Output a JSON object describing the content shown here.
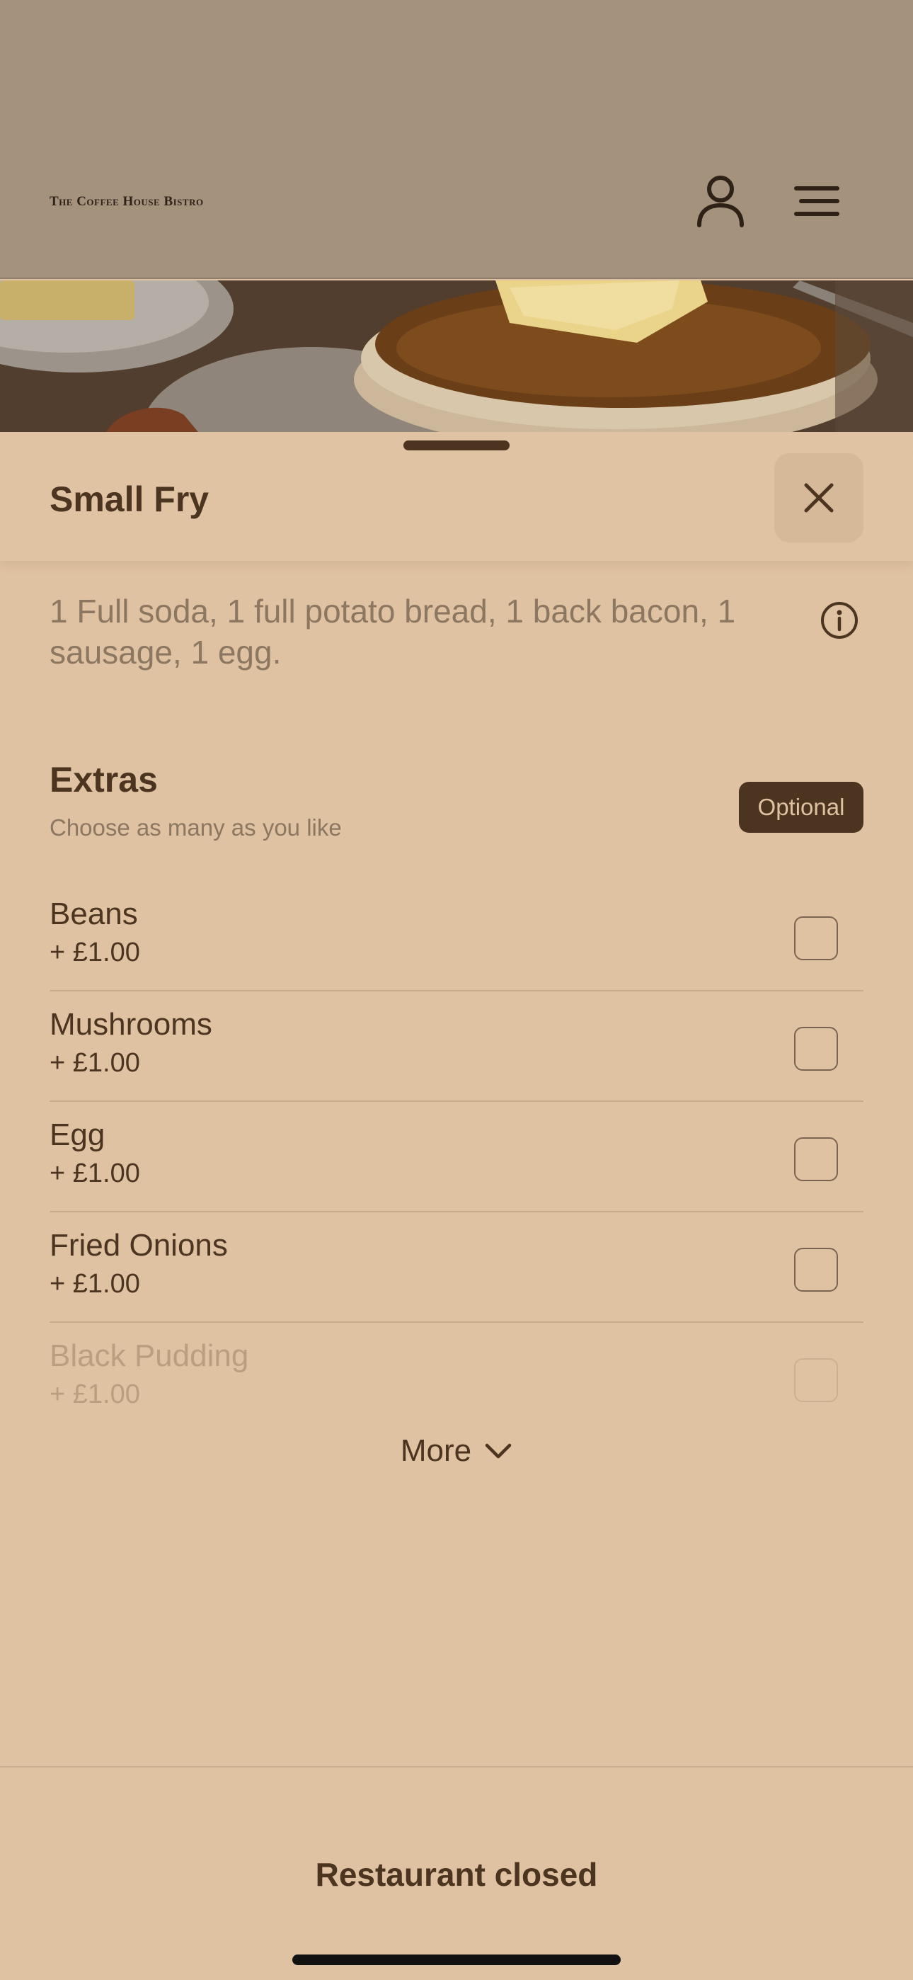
{
  "header": {
    "logo_text": "The Coffee House Bistro",
    "account_icon": "user-icon",
    "menu_icon": "hamburger-menu-icon"
  },
  "item": {
    "title": "Small Fry",
    "close_icon": "close-icon",
    "description": "1 Full soda, 1 full potato bread, 1 back bacon, 1 sausage, 1 egg.",
    "info_icon": "info-icon"
  },
  "extras": {
    "title": "Extras",
    "subtitle": "Choose as many as you like",
    "badge": "Optional",
    "options": [
      {
        "name": "Beans",
        "price": "+ £1.00",
        "checked": false
      },
      {
        "name": "Mushrooms",
        "price": "+ £1.00",
        "checked": false
      },
      {
        "name": "Egg",
        "price": "+ £1.00",
        "checked": false
      },
      {
        "name": "Fried Onions",
        "price": "+ £1.00",
        "checked": false
      },
      {
        "name": "Black Pudding",
        "price": "+ £1.00",
        "checked": false
      }
    ],
    "more_label": "More",
    "more_icon": "chevron-down-icon"
  },
  "footer": {
    "status": "Restaurant closed"
  },
  "colors": {
    "sheet_bg": "#dfc2a2",
    "text_dark": "#4b3520",
    "text_muted": "#8c7761",
    "header_overlay": "#a5927d"
  }
}
